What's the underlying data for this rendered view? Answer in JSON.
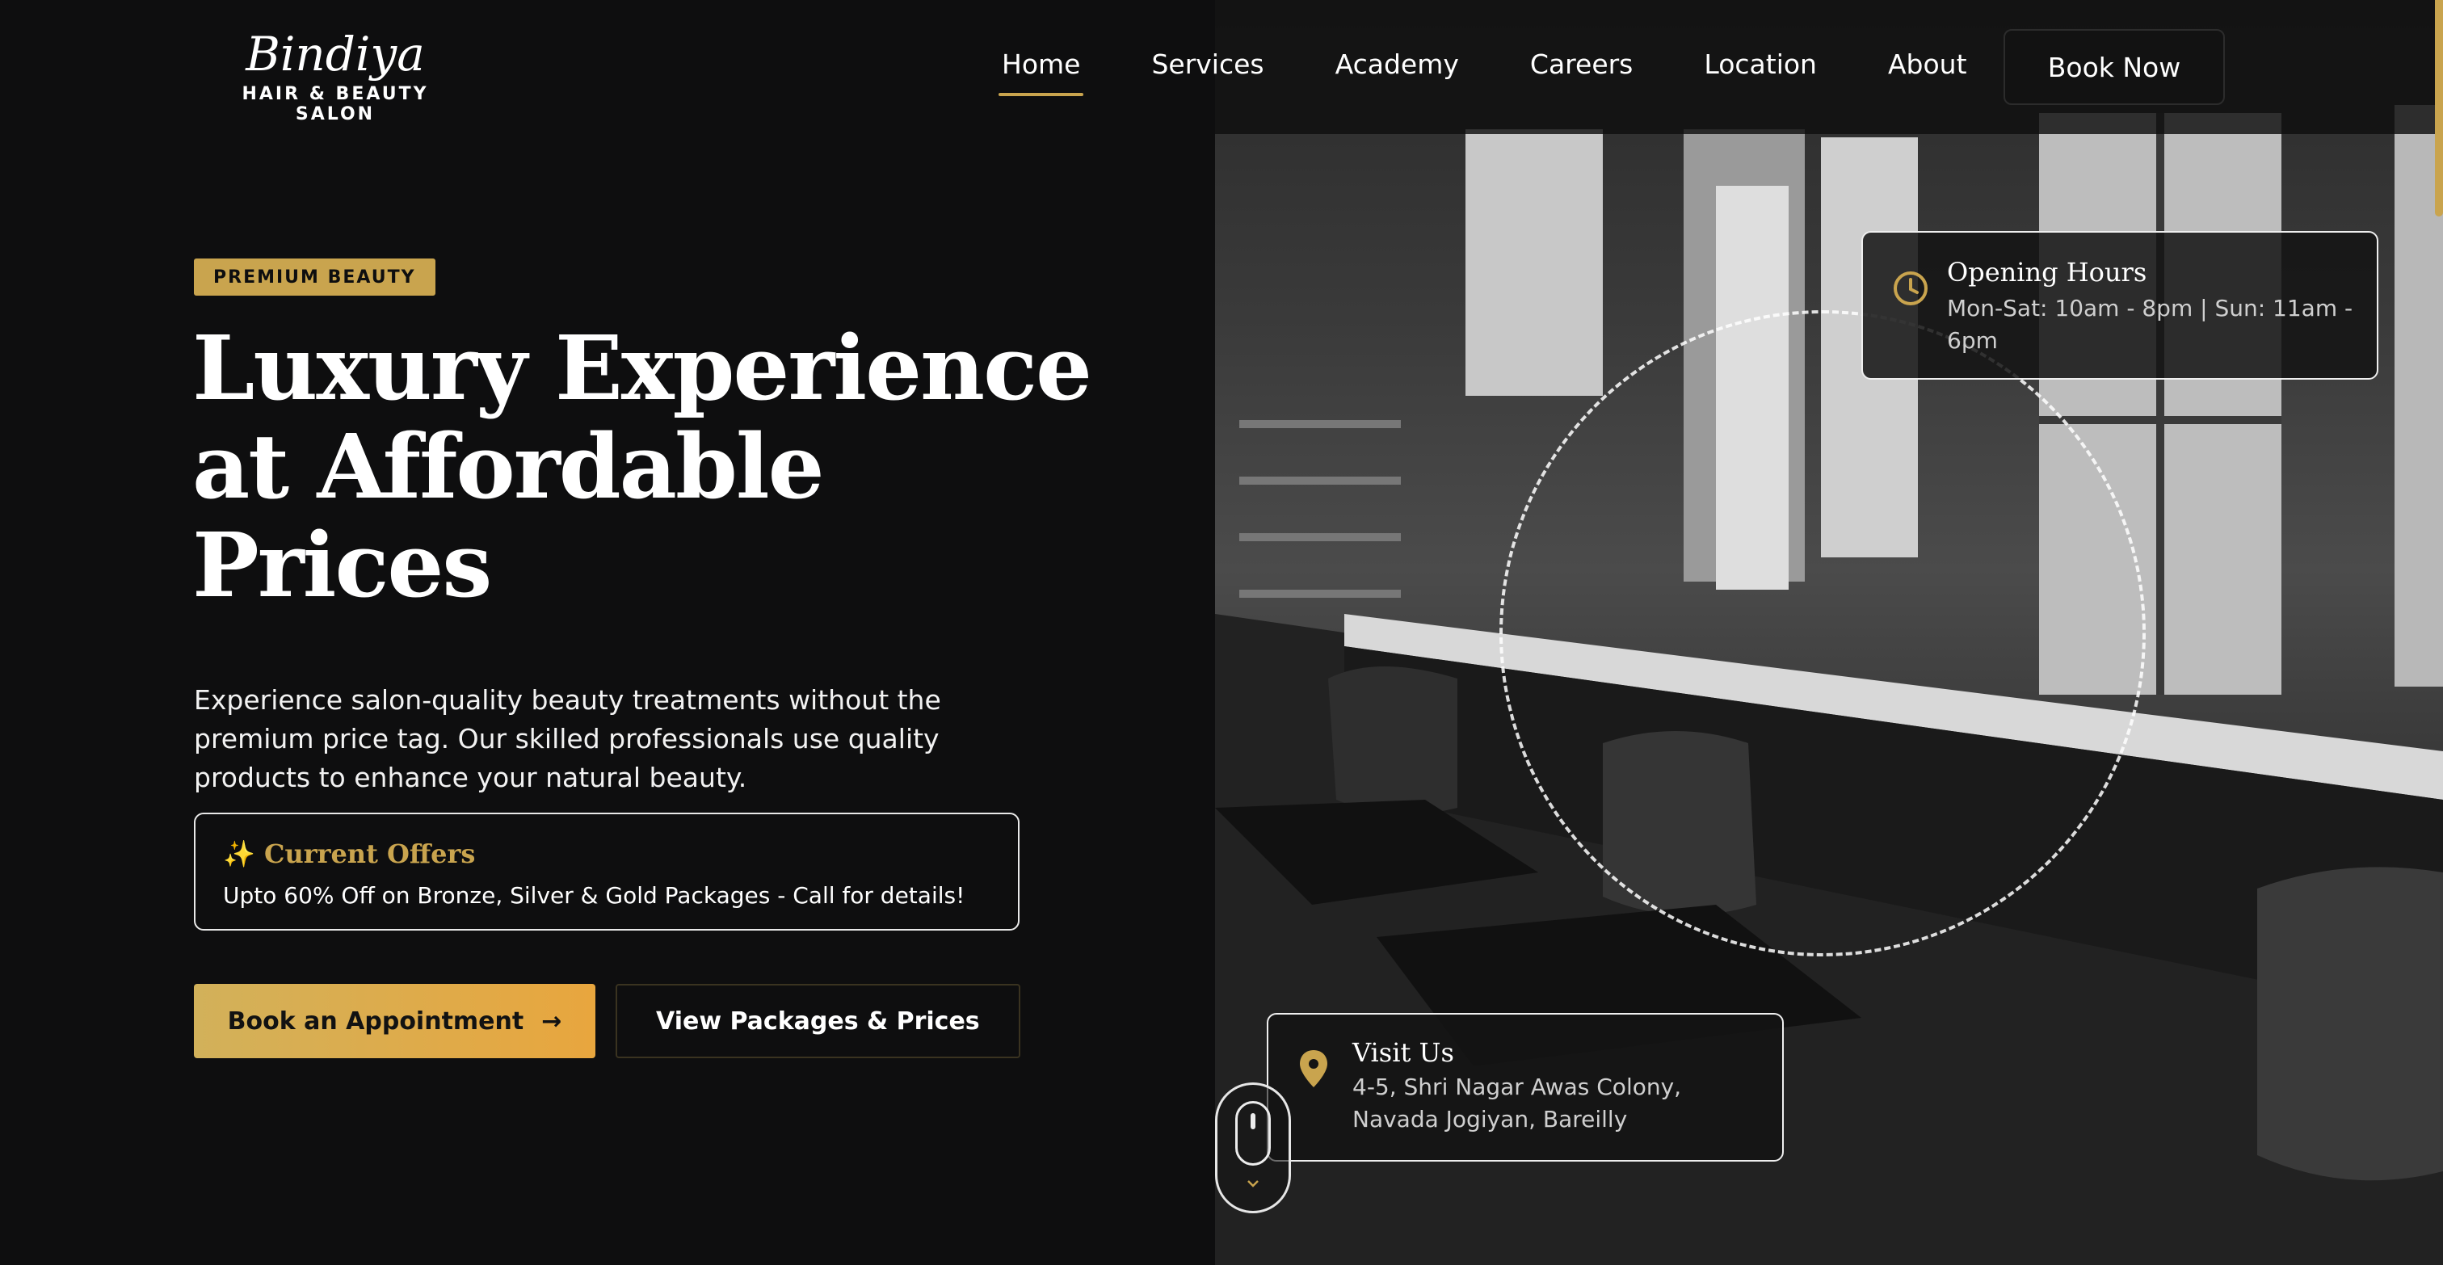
{
  "brand": {
    "name": "Bindiya",
    "tagline": "HAIR & BEAUTY SALON"
  },
  "nav": {
    "items": [
      {
        "label": "Home",
        "active": true
      },
      {
        "label": "Services"
      },
      {
        "label": "Academy"
      },
      {
        "label": "Careers"
      },
      {
        "label": "Location"
      },
      {
        "label": "About"
      }
    ],
    "cta_label": "Book Now"
  },
  "hero": {
    "badge": "PREMIUM BEAUTY",
    "headline_lines": [
      "Luxury Experience",
      "at Affordable",
      "Prices"
    ],
    "description": "Experience salon-quality beauty treatments without the premium price tag. Our skilled professionals use quality products to enhance your natural beauty.",
    "offer": {
      "icon": "sparkles-icon",
      "title": "✨ Current Offers",
      "text": "Upto 60% Off on Bronze, Silver & Gold Packages - Call for details!"
    },
    "primary_button": "Book an Appointment",
    "secondary_button": "View Packages & Prices"
  },
  "cards": {
    "hours": {
      "icon": "clock-icon",
      "title": "Opening Hours",
      "text": "Mon-Sat: 10am - 8pm | Sun: 11am - 6pm"
    },
    "visit": {
      "icon": "map-pin-icon",
      "title": "Visit Us",
      "text": "4-5, Shri Nagar Awas Colony, Navada Jogiyan, Bareilly"
    }
  },
  "colors": {
    "accent": "#c9a44e",
    "background": "#0e0e0f",
    "button_gradient_end": "#e8a63e"
  }
}
